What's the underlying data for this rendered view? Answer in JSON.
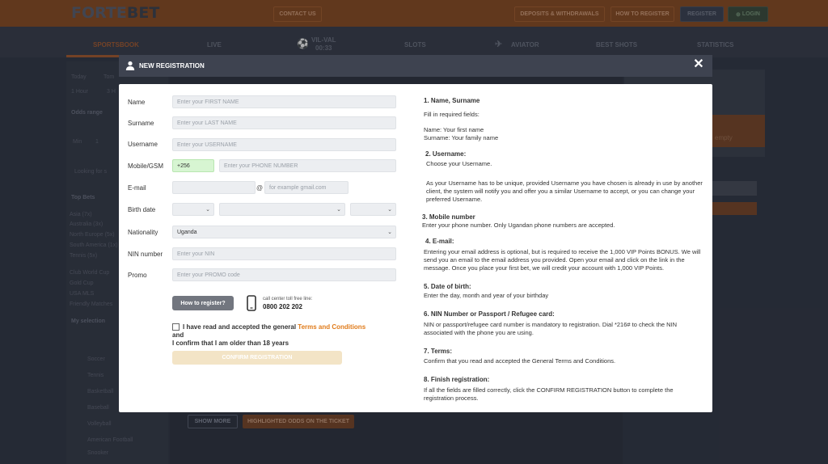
{
  "site": {
    "logo_primary": "FORTE",
    "logo_secondary": "BET",
    "topbar": {
      "contact": "CONTACT US",
      "deposits": "DEPOSITS & WITHDRAWALS",
      "how_to_register": "HOW TO REGISTER",
      "register": "REGISTER",
      "login": "LOGIN"
    },
    "nav": {
      "sportsbook": "SPORTSBOOK",
      "live": "LIVE",
      "match": "VIL-VAL",
      "match_time": "00:33",
      "slots": "SLOTS",
      "aviator": "AVIATOR",
      "best_shots": "BEST SHOTS",
      "statistics": "STATISTICS"
    },
    "left": {
      "today": "Today",
      "tomorrow": "Tom",
      "one_hour": "1 Hour",
      "three_h": "3 H",
      "odds_range": "Odds range",
      "min": "Min",
      "min_val": "1",
      "looking_for": "Looking for s",
      "top_bets": "Top Bets",
      "asia": "Asia (7x)",
      "australia": "Australia (3x)",
      "north_europe": "North Europe (5x)",
      "south_america": "South America (1x)",
      "tennis_5x": "Tennis (5x)",
      "club_world_cup": "Club World Cup",
      "gold_cup": "Gold Cup",
      "usa_mls": "USA MLS",
      "friendly": "Friendly Matches",
      "my_selection": "My selection",
      "soccer": "Soccer",
      "tennis": "Tennis",
      "basketball": "Basketball",
      "baseball": "Baseball",
      "volleyball": "Volleyball",
      "american_football": "American Football",
      "snooker": "Snooker"
    },
    "right": {
      "empty": "empty"
    },
    "bottom": {
      "show_more": "SHOW MORE",
      "highlighted": "HIGHLIGHTED ODDS ON THE TICKET"
    }
  },
  "modal": {
    "title": "NEW REGISTRATION",
    "form": {
      "name_label": "Name",
      "name_placeholder": "Enter your FIRST NAME",
      "surname_label": "Surname",
      "surname_placeholder": "Enter your LAST NAME",
      "username_label": "Username",
      "username_placeholder": "Enter your USERNAME",
      "mobile_label": "Mobile/GSM",
      "mobile_prefix": "+256",
      "phone_placeholder": "Enter your PHONE NUMBER",
      "email_label": "E-mail",
      "email_at": "@",
      "email_domain_placeholder": "for example gmail.com",
      "birth_label": "Birth date",
      "nationality_label": "Nationality",
      "nationality_value": "Uganda",
      "nin_label": "NIN number",
      "nin_placeholder": "Enter your NIN",
      "promo_label": "Promo",
      "promo_placeholder": "Enter your PROMO code",
      "how_to_register": "How to register?",
      "call_center_label": "call center toll free line:",
      "call_center_number": "0800 202 202",
      "terms_prefix": "I have read and accepted the general ",
      "terms_link": "Terms and Conditions",
      "terms_and": " and",
      "terms_age": "I confirm that I am older than 18 years",
      "confirm": "CONFIRM REGISTRATION"
    },
    "info": {
      "s1_title": "1. Name, Surname",
      "s1_fill": "Fill in required fields:",
      "s1_name": "Name: Your first name",
      "s1_surname": "Surname: Your family name",
      "s2_title": "2. Username:",
      "s2_choose": "Choose your Username.",
      "s2_text": "As your Username has to be unique, provided Username you have chosen is already in use by another client, the system will notify you and offer you a similar Username to accept, or you can change your preferred Username.",
      "s3_title": "3. Mobile number",
      "s3_text": "Enter your phone number. Only Ugandan phone numbers are accepted.",
      "s4_title": "4. E-mail:",
      "s4_text": "Entering your email address is optional, but is required to receive the 1,000 VIP Points BONUS. We will send you an email to the email address you provided. Open your email and click on the link in the message. Once you place your first bet, we will credit your account with 1,000 VIP Points.",
      "s5_title": "5. Date of birth:",
      "s5_text": "Enter the day, month and year of your birthday",
      "s6_title": "6. NIN Number or Passport / Refugee card:",
      "s6_text": "NIN or passport/refugee card number is mandatory to registration. Dial *216# to check the NIN associated with the phone you are using.",
      "s7_title": "7. Terms:",
      "s7_text": "Confirm that you read and accepted the General Terms and Conditions.",
      "s8_title": "8. Finish registration:",
      "s8_text": "If all the fields are filled correctly, click the CONFIRM REGISTRATION button to complete the registration process."
    }
  },
  "colors": {
    "accent_orange": "#e07b1a",
    "mobile_prefix_bg": "#d7f5d2",
    "header_bar": "#3e4350",
    "confirm_disabled": "#f3e4c6"
  }
}
